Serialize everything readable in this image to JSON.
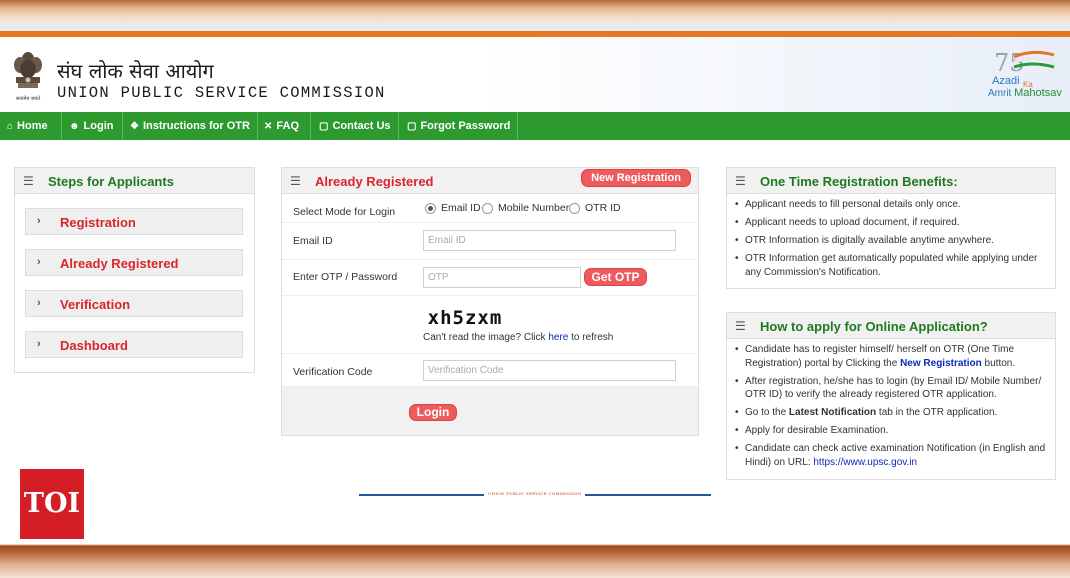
{
  "header": {
    "title_hindi": "संघ लोक सेवा आयोग",
    "title_english": "UNION PUBLIC SERVICE COMMISSION",
    "emblem_caption": "सत्यमेव जयते",
    "azadi_logo": {
      "numeral": "75",
      "word1": "Azadi",
      "word2": "Ka",
      "word3a": "Amrit",
      "word3b": "Mahotsav"
    }
  },
  "nav": {
    "items": [
      {
        "label": "Home",
        "icon": "home-icon"
      },
      {
        "label": "Login",
        "icon": "user-icon"
      },
      {
        "label": "Instructions for OTR",
        "icon": "info-icon"
      },
      {
        "label": "FAQ",
        "icon": "tools-icon"
      },
      {
        "label": "Contact Us",
        "icon": "document-icon"
      },
      {
        "label": "Forgot Password",
        "icon": "document-icon"
      }
    ]
  },
  "steps": {
    "title": "Steps for Applicants",
    "items": [
      {
        "label": "Registration"
      },
      {
        "label": "Already Registered"
      },
      {
        "label": "Verification"
      },
      {
        "label": "Dashboard"
      }
    ]
  },
  "login_form": {
    "title": "Already Registered",
    "new_registration": "New Registration",
    "mode_label": "Select Mode for Login",
    "modes": [
      "Email ID",
      "Mobile Number",
      "OTR ID"
    ],
    "selected_mode": "Email ID",
    "email_label": "Email ID",
    "email_placeholder": "Email ID",
    "otp_label": "Enter OTP / Password",
    "otp_placeholder": "OTP",
    "get_otp": "Get OTP",
    "captcha_text": "xh5zxm",
    "refresh_prefix": "Can't read the image? Click ",
    "refresh_link": "here",
    "refresh_suffix": " to refresh",
    "verification_label": "Verification Code",
    "verification_placeholder": "Verification Code",
    "login_button": "Login"
  },
  "benefits": {
    "title": "One Time Registration Benefits:",
    "items": [
      "Applicant needs to fill personal details only once.",
      "Applicant needs to upload document, if required.",
      "OTR Information is digitally available anytime anywhere.",
      "OTR Information get automatically populated while applying under any Commission's Notification."
    ]
  },
  "how_to": {
    "title": "How to apply for Online Application?",
    "item1_a": "Candidate has to register himself/ herself on OTR (One Time Registration) portal by Clicking the ",
    "item1_link": "New Registration",
    "item1_b": " button.",
    "item2": "After registration, he/she has to login (by Email ID/ Mobile Number/ OTR ID) to verify the already registered OTR application.",
    "item3_a": "Go to the ",
    "item3_bold": "Latest Notification",
    "item3_b": " tab in the OTR application.",
    "item4": "Apply for desirable Examination.",
    "item5_a": "Candidate can check active examination Notification (in English and Hindi) on URL: ",
    "item5_link": "https://www.upsc.gov.in"
  },
  "footer": {
    "text": "UNION PUBLIC SERVICE COMMISSION"
  },
  "watermark": {
    "text": "TOI"
  },
  "colors": {
    "nav_green": "#2d9a2f",
    "accent_red": "#d9262c",
    "pill_red": "#ee5b5d",
    "link_blue": "#0a2bb8",
    "saffron": "#e87722"
  }
}
